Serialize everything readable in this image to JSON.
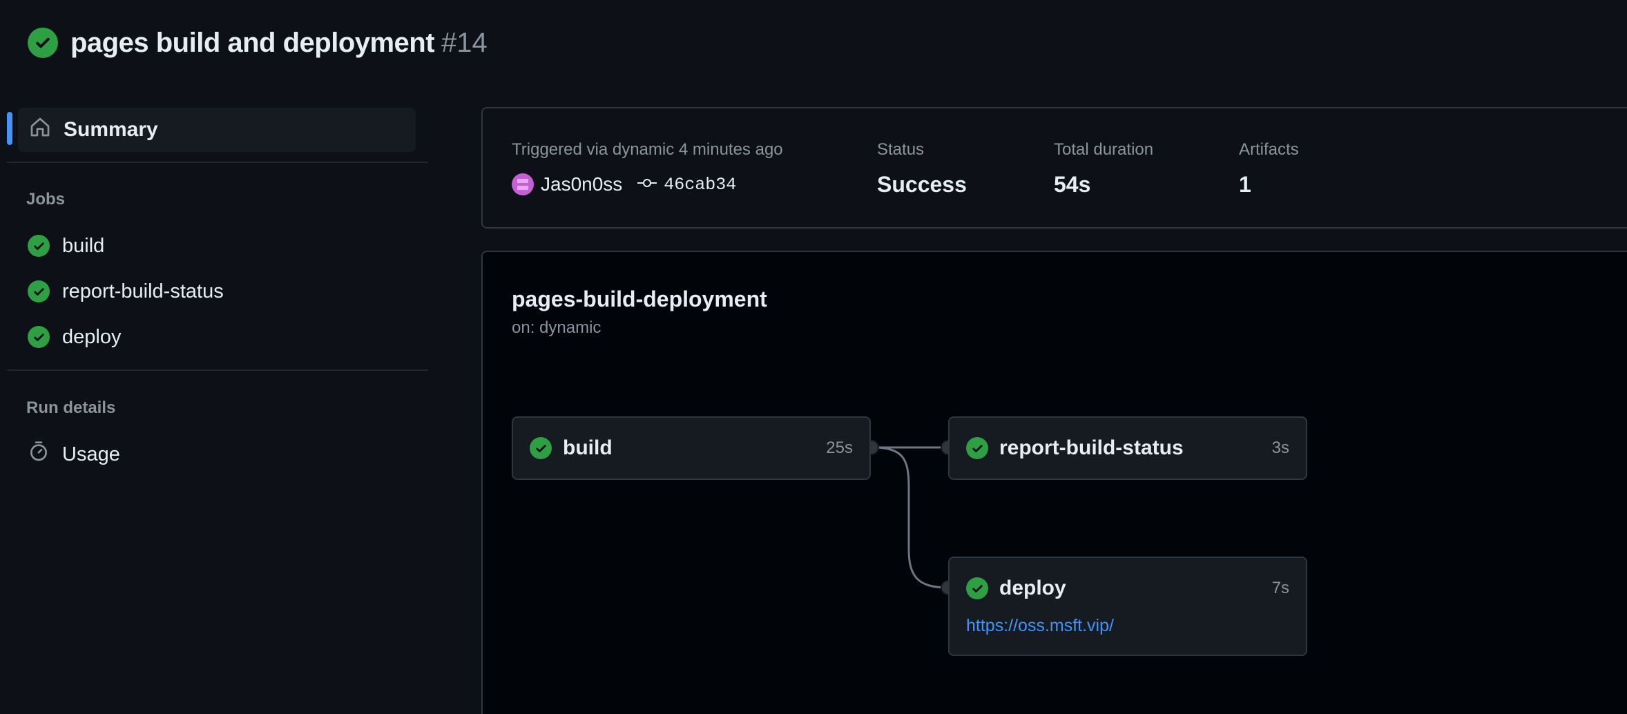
{
  "run": {
    "title": "pages build and deployment",
    "number": "#14",
    "status_icon": "check-circle-icon"
  },
  "sidebar": {
    "summary_label": "Summary",
    "jobs_heading": "Jobs",
    "jobs": [
      {
        "label": "build"
      },
      {
        "label": "report-build-status"
      },
      {
        "label": "deploy"
      }
    ],
    "run_details_heading": "Run details",
    "usage_label": "Usage"
  },
  "summary": {
    "triggered_text": "Triggered via dynamic 4 minutes ago",
    "actor": "Jas0n0ss",
    "commit": "46cab34",
    "status_label": "Status",
    "status_value": "Success",
    "duration_label": "Total duration",
    "duration_value": "54s",
    "artifacts_label": "Artifacts",
    "artifacts_value": "1"
  },
  "workflow": {
    "name": "pages-build-deployment",
    "trigger": "on: dynamic",
    "jobs": {
      "build": {
        "name": "build",
        "duration": "25s"
      },
      "report": {
        "name": "report-build-status",
        "duration": "3s"
      },
      "deploy": {
        "name": "deploy",
        "duration": "7s",
        "url": "https://oss.msft.vip/"
      }
    }
  },
  "colors": {
    "background": "#0d1117",
    "success": "#2ea043",
    "accent": "#4493f8",
    "border": "#30363d"
  }
}
